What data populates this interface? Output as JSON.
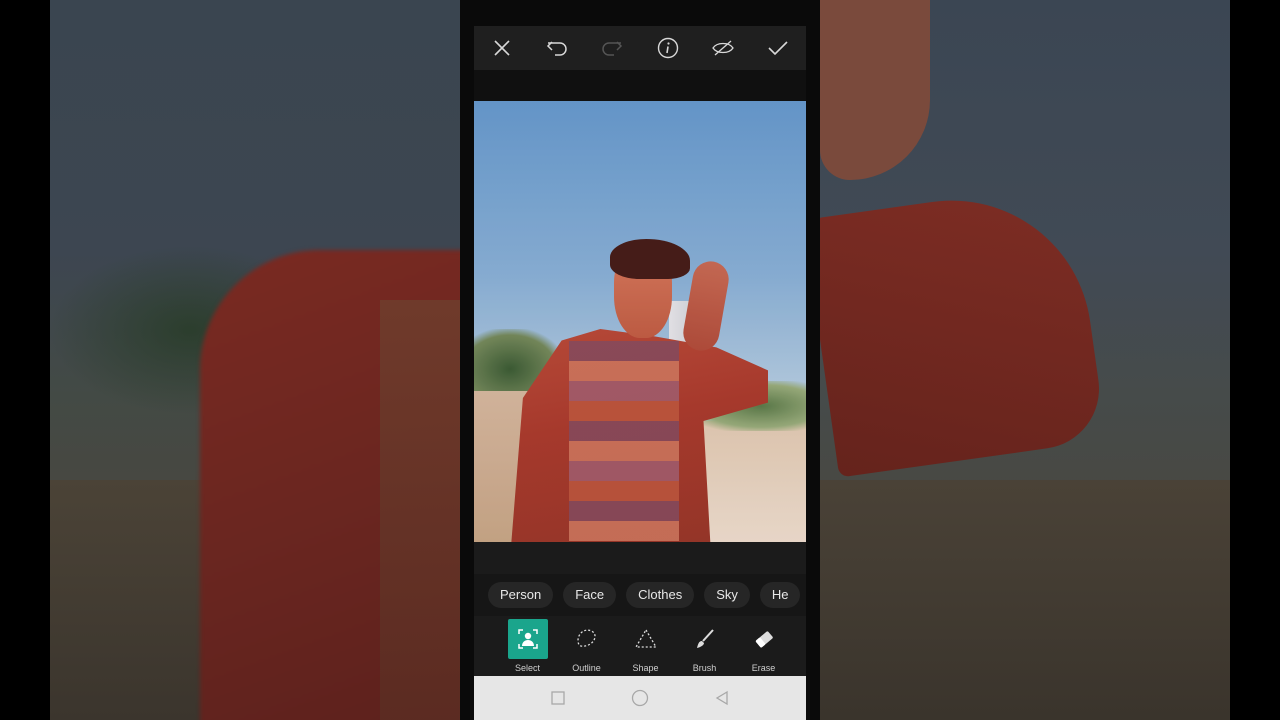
{
  "toolbar": {
    "buttons": [
      {
        "name": "close-icon"
      },
      {
        "name": "undo-icon"
      },
      {
        "name": "redo-icon"
      },
      {
        "name": "info-icon"
      },
      {
        "name": "hide-icon"
      },
      {
        "name": "check-icon"
      }
    ]
  },
  "select_chips": [
    "Person",
    "Face",
    "Clothes",
    "Sky",
    "He"
  ],
  "tools": [
    {
      "label": "Select",
      "icon": "person-select-icon",
      "active": true
    },
    {
      "label": "Outline",
      "icon": "lasso-outline-icon",
      "active": false
    },
    {
      "label": "Shape",
      "icon": "triangle-shape-icon",
      "active": false
    },
    {
      "label": "Brush",
      "icon": "brush-icon",
      "active": false
    },
    {
      "label": "Erase",
      "icon": "eraser-icon",
      "active": false
    }
  ],
  "colors": {
    "accent": "#1aa58c",
    "toolbar_bg": "#1f1f1f",
    "chip_bg": "#262626",
    "nav_bg": "#e6e6e6"
  }
}
